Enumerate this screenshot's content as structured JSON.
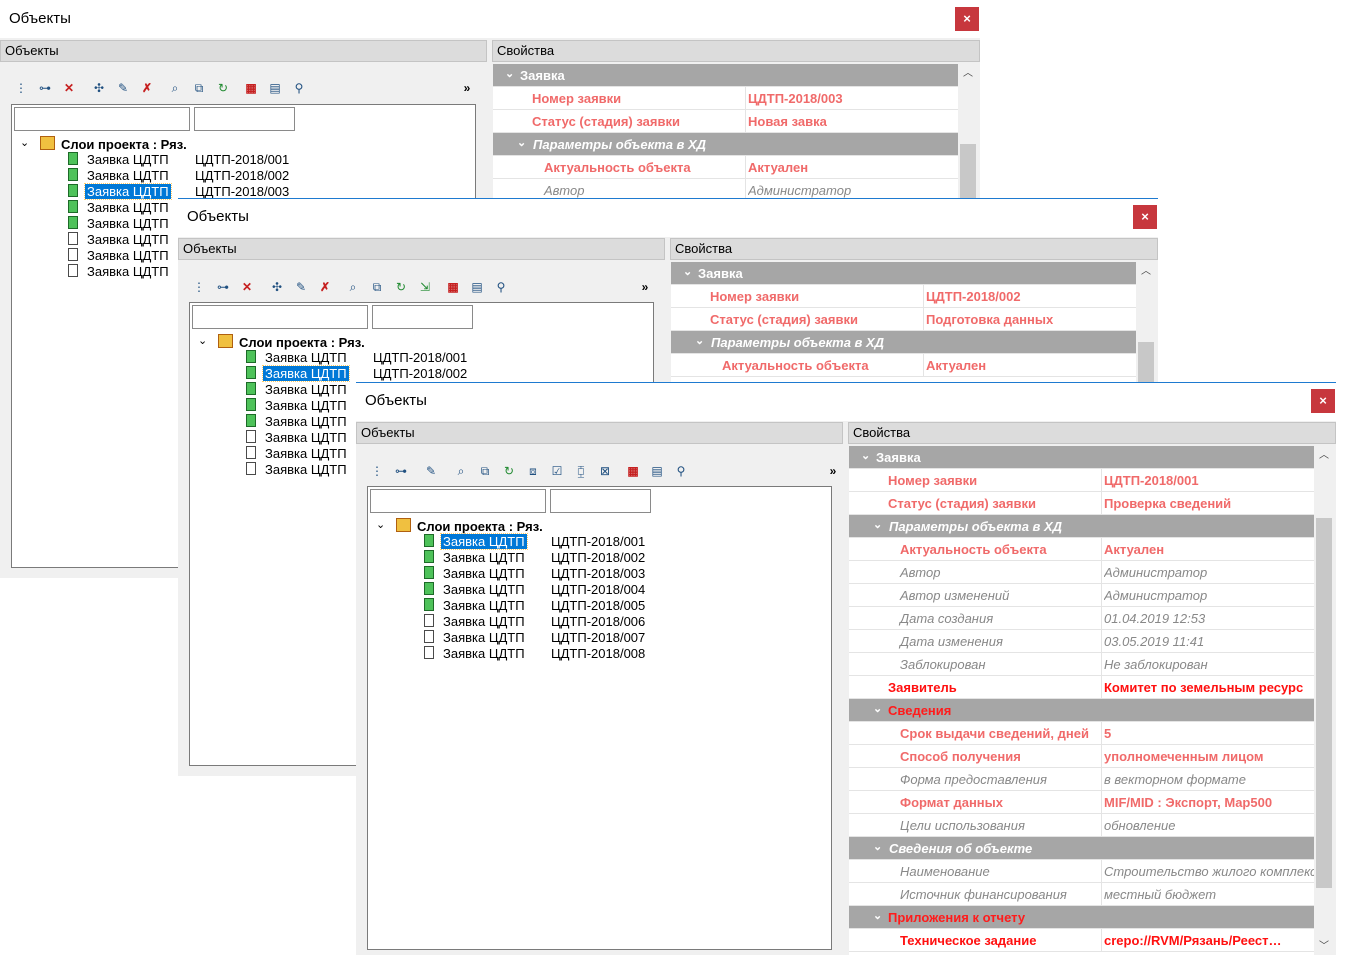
{
  "colors": {
    "title_accent": "#1e7ad0",
    "close_bg": "#c7373d",
    "selection": "#0078d7",
    "group_bg": "#a6a6a6",
    "required_text": "#f06a6a",
    "error_text": "#ff1010"
  },
  "windows": [
    {
      "title": "Объекты",
      "close_label": "×",
      "objects_header": "Объекты",
      "properties_header": "Свойства",
      "more_label": "»",
      "tree": {
        "root": "Слои проекта : Ряз.",
        "items": [
          {
            "name": "Заявка ЦДТП",
            "value": "ЦДТП-2018/001",
            "icon": "green-document-icon"
          },
          {
            "name": "Заявка ЦДТП",
            "value": "ЦДТП-2018/002",
            "icon": "green-document-icon"
          },
          {
            "name": "Заявка ЦДТП",
            "value": "ЦДТП-2018/003",
            "icon": "green-document-icon",
            "selected": true
          },
          {
            "name": "Заявка ЦДТП",
            "value": "",
            "icon": "green-document-icon"
          },
          {
            "name": "Заявка ЦДТП",
            "value": "",
            "icon": "green-document-icon"
          },
          {
            "name": "Заявка ЦДТП",
            "value": "",
            "icon": "document-icon"
          },
          {
            "name": "Заявка ЦДТП",
            "value": "",
            "icon": "document-icon"
          },
          {
            "name": "Заявка ЦДТП",
            "value": "",
            "icon": "document-icon"
          }
        ]
      },
      "properties": [
        {
          "type": "group-top",
          "key": "Заявка"
        },
        {
          "type": "pink",
          "key": "Номер заявки",
          "value": "ЦДТП-2018/003"
        },
        {
          "type": "pink",
          "key": "Статус (стадия) заявки",
          "value": "Новая завка"
        },
        {
          "type": "group",
          "key": "Параметры объекта в ХД"
        },
        {
          "type": "pink",
          "key": "Актуальность объекта",
          "value": "Актуален",
          "indent": 2
        },
        {
          "type": "gray",
          "key": "Автор",
          "value": "Администратор",
          "indent": 2
        }
      ]
    },
    {
      "title": "Объекты",
      "close_label": "×",
      "objects_header": "Объекты",
      "properties_header": "Свойства",
      "more_label": "»",
      "tree": {
        "root": "Слои проекта : Ряз.",
        "items": [
          {
            "name": "Заявка ЦДТП",
            "value": "ЦДТП-2018/001",
            "icon": "green-document-icon"
          },
          {
            "name": "Заявка ЦДТП",
            "value": "ЦДТП-2018/002",
            "icon": "green-document-icon",
            "selected": true
          },
          {
            "name": "Заявка ЦДТП",
            "value": "",
            "icon": "green-document-icon"
          },
          {
            "name": "Заявка ЦДТП",
            "value": "",
            "icon": "green-document-icon"
          },
          {
            "name": "Заявка ЦДТП",
            "value": "",
            "icon": "green-document-icon"
          },
          {
            "name": "Заявка ЦДТП",
            "value": "",
            "icon": "document-icon"
          },
          {
            "name": "Заявка ЦДТП",
            "value": "",
            "icon": "document-icon"
          },
          {
            "name": "Заявка ЦДТП",
            "value": "",
            "icon": "document-icon"
          }
        ]
      },
      "properties": [
        {
          "type": "group-top",
          "key": "Заявка"
        },
        {
          "type": "pink",
          "key": "Номер заявки",
          "value": "ЦДТП-2018/002"
        },
        {
          "type": "pink",
          "key": "Статус (стадия) заявки",
          "value": "Подготовка данных"
        },
        {
          "type": "group",
          "key": "Параметры объекта в ХД"
        },
        {
          "type": "pink",
          "key": "Актуальность объекта",
          "value": "Актуален",
          "indent": 2
        }
      ]
    },
    {
      "title": "Объекты",
      "close_label": "×",
      "objects_header": "Объекты",
      "properties_header": "Свойства",
      "more_label": "»",
      "tree": {
        "root": "Слои проекта : Ряз.",
        "items": [
          {
            "name": "Заявка ЦДТП",
            "value": "ЦДТП-2018/001",
            "icon": "green-document-icon",
            "selected": true
          },
          {
            "name": "Заявка ЦДТП",
            "value": "ЦДТП-2018/002",
            "icon": "green-document-icon"
          },
          {
            "name": "Заявка ЦДТП",
            "value": "ЦДТП-2018/003",
            "icon": "green-document-icon"
          },
          {
            "name": "Заявка ЦДТП",
            "value": "ЦДТП-2018/004",
            "icon": "green-document-icon"
          },
          {
            "name": "Заявка ЦДТП",
            "value": "ЦДТП-2018/005",
            "icon": "green-document-icon"
          },
          {
            "name": "Заявка ЦДТП",
            "value": "ЦДТП-2018/006",
            "icon": "document-icon"
          },
          {
            "name": "Заявка ЦДТП",
            "value": "ЦДТП-2018/007",
            "icon": "document-icon"
          },
          {
            "name": "Заявка ЦДТП",
            "value": "ЦДТП-2018/008",
            "icon": "document-icon"
          }
        ]
      },
      "properties": [
        {
          "type": "group-top",
          "key": "Заявка"
        },
        {
          "type": "pink",
          "key": "Номер заявки",
          "value": "ЦДТП-2018/001"
        },
        {
          "type": "pink",
          "key": "Статус (стадия) заявки",
          "value": "Проверка сведений"
        },
        {
          "type": "group",
          "key": "Параметры объекта в ХД"
        },
        {
          "type": "pink",
          "key": "Актуальность объекта",
          "value": "Актуален",
          "indent": 2
        },
        {
          "type": "gray",
          "key": "Автор",
          "value": "Администратор",
          "indent": 2
        },
        {
          "type": "gray",
          "key": "Автор изменений",
          "value": "Администратор",
          "indent": 2
        },
        {
          "type": "gray",
          "key": "Дата создания",
          "value": "01.04.2019 12:53",
          "indent": 2
        },
        {
          "type": "gray",
          "key": "Дата изменения",
          "value": "03.05.2019 11:41",
          "indent": 2
        },
        {
          "type": "gray",
          "key": "Заблокирован",
          "value": "Не заблокирован",
          "indent": 2
        },
        {
          "type": "red",
          "key": "Заявитель",
          "value": "Комитет по земельным ресурс"
        },
        {
          "type": "group-top-red",
          "key": "Сведения"
        },
        {
          "type": "pink",
          "key": "Срок выдачи сведений, дней",
          "value": "5",
          "indent": 2
        },
        {
          "type": "pink",
          "key": "Способ получения",
          "value": "уполномеченным лицом",
          "indent": 2
        },
        {
          "type": "gray",
          "key": "Форма предоставления",
          "value": "в векторном формате",
          "indent": 2
        },
        {
          "type": "pink",
          "key": "Формат данных",
          "value": "MIF/MID : Экспорт, Map500",
          "indent": 2
        },
        {
          "type": "gray",
          "key": "Цели использования",
          "value": "обновление",
          "indent": 2
        },
        {
          "type": "group",
          "key": "Сведения об объекте"
        },
        {
          "type": "gray",
          "key": "Наименование",
          "value": "Строительство жилого комплекса",
          "indent": 2
        },
        {
          "type": "gray",
          "key": "Источник финансирования",
          "value": "местный бюджет",
          "indent": 2
        },
        {
          "type": "group-top-red",
          "key": "Приложения к отчету"
        },
        {
          "type": "red",
          "key": "Техническое задание",
          "value": "crepo://RVM/Рязань/Реест…",
          "indent": 2
        }
      ]
    }
  ]
}
